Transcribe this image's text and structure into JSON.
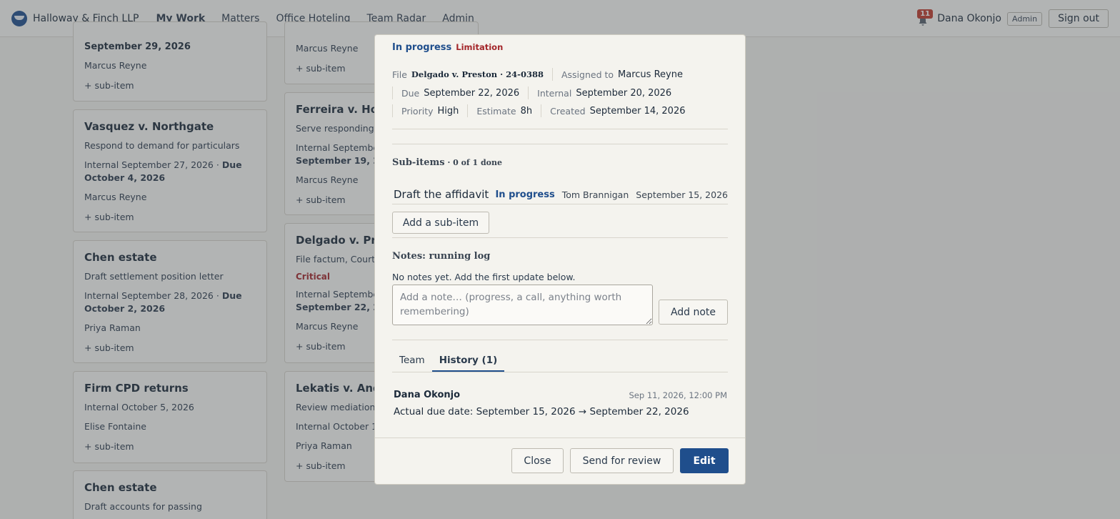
{
  "header": {
    "firm_name": "Halloway & Finch LLP",
    "nav": [
      "My Work",
      "Matters",
      "Office Hoteling",
      "Team Radar",
      "Admin"
    ],
    "notifications_count": "11",
    "user_name": "Dana Okonjo",
    "user_role": "Admin",
    "sign_out_label": "Sign out"
  },
  "board": {
    "col1": [
      {
        "date": "September 29, 2026",
        "assignee": "Marcus Reyne",
        "sub": "+ sub-item"
      },
      {
        "title": "Vasquez v. Northgate",
        "task": "Respond to demand for particulars",
        "internal": "Internal September 27, 2026 · ",
        "due_prefix": "Due",
        "due": "October 4, 2026",
        "assignee": "Marcus Reyne",
        "sub": "+ sub-item"
      },
      {
        "title": "Chen estate",
        "task": "Draft settlement position letter",
        "internal": "Internal September 28, 2026 · ",
        "due_prefix": "Due",
        "due": "October 2, 2026",
        "assignee": "Priya Raman",
        "sub": "+ sub-item"
      },
      {
        "title": "Firm CPD returns",
        "task": "Internal October 5, 2026",
        "assignee": "Elise Fontaine",
        "sub": "+ sub-item"
      },
      {
        "title": "Chen estate",
        "task": "Draft accounts for passing"
      }
    ],
    "col2": [
      {
        "assignee": "Marcus Reyne",
        "sub": "+ sub-item"
      },
      {
        "title": "Ferreira v. Hol",
        "task": "Serve responding r",
        "internal": "Internal Septembe",
        "due": "September 19, 2",
        "assignee": "Marcus Reyne",
        "sub": "+ sub-item"
      },
      {
        "title": "Delgado v. Pre",
        "task": "File factum, Court",
        "flag": "Critical",
        "internal": "Internal Septembe",
        "due": "September 22, 2",
        "assignee": "Marcus Reyne",
        "sub": "+ sub-item"
      },
      {
        "title": "Lekatis v. And",
        "task": "Review mediation",
        "internal": "Internal October 1",
        "assignee": "Priya Raman",
        "sub": "+ sub-item"
      }
    ]
  },
  "modal": {
    "status": "In progress",
    "tag": "Limitation",
    "meta": {
      "file_label": "File",
      "file_value": "Delgado v. Preston · 24-0388",
      "assigned_label": "Assigned to",
      "assigned_value": "Marcus Reyne",
      "due_label": "Due",
      "due_value": "September 22, 2026",
      "internal_label": "Internal",
      "internal_value": "September 20, 2026",
      "priority_label": "Priority",
      "priority_value": "High",
      "estimate_label": "Estimate",
      "estimate_value": "8h",
      "created_label": "Created",
      "created_value": "September 14, 2026"
    },
    "subitems": {
      "heading": "Sub-items",
      "progress": " · 0 of 1 done",
      "items": [
        {
          "title": "Draft the affidavit",
          "status": "In progress",
          "assignee": "Tom Brannigan",
          "date": "September 15, 2026"
        }
      ],
      "add_label": "Add a sub-item"
    },
    "notes": {
      "heading": "Notes: running log",
      "empty_text": "No notes yet. Add the first update below.",
      "placeholder": "Add a note… (progress, a call, anything worth remembering)",
      "add_label": "Add note"
    },
    "tabs": [
      "Team",
      "History (1)"
    ],
    "history": [
      {
        "author": "Dana Okonjo",
        "time": "Sep 11, 2026, 12:00 PM",
        "change": "Actual due date: September 15, 2026 → September 22, 2026"
      }
    ],
    "footer": {
      "close_label": "Close",
      "review_label": "Send for review",
      "edit_label": "Edit"
    }
  },
  "colors": {
    "accent": "#1f4e8c",
    "critical": "#a3262a",
    "badge": "#c0392b"
  }
}
